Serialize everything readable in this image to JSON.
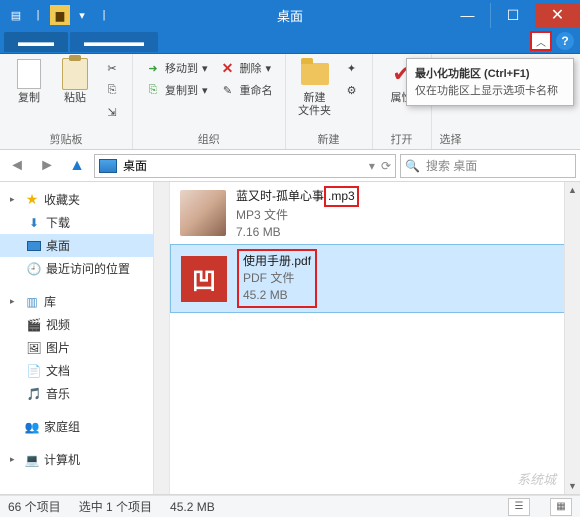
{
  "title": "桌面",
  "ribbon": {
    "groups": {
      "clipboard": {
        "label": "剪贴板",
        "copy": "复制",
        "paste": "粘贴"
      },
      "organize": {
        "label": "组织",
        "move_to": "移动到",
        "copy_to": "复制到",
        "delete": "删除",
        "rename": "重命名"
      },
      "new": {
        "label": "新建",
        "new_folder": "新建\n文件夹"
      },
      "open": {
        "label": "打开",
        "properties": "属性"
      },
      "select": {
        "label": "选择"
      }
    }
  },
  "tooltip": {
    "title": "最小化功能区 (Ctrl+F1)",
    "body": "仅在功能区上显示选项卡名称"
  },
  "address": {
    "path": "桌面"
  },
  "search": {
    "placeholder": "搜索 桌面"
  },
  "sidebar": {
    "favorites": {
      "label": "收藏夹",
      "items": [
        "下载",
        "桌面",
        "最近访问的位置"
      ]
    },
    "libraries": {
      "label": "库",
      "items": [
        "视频",
        "图片",
        "文档",
        "音乐"
      ]
    },
    "homegroup": {
      "label": "家庭组"
    },
    "computer": {
      "label": "计算机"
    }
  },
  "files": [
    {
      "name_main": "蓝又时-孤单心事",
      "name_ext": ".mp3",
      "type": "MP3 文件",
      "size": "7.16 MB",
      "selected": false,
      "highlight_ext": true,
      "icon": "photo"
    },
    {
      "name_main": "使用手册",
      "name_ext": ".pdf",
      "type": "PDF 文件",
      "size": "45.2 MB",
      "selected": true,
      "highlight_all": true,
      "icon": "pdf"
    }
  ],
  "status": {
    "item_count": "66 个项目",
    "selection": "选中 1 个项目",
    "size": "45.2 MB"
  },
  "watermark": "系统城"
}
